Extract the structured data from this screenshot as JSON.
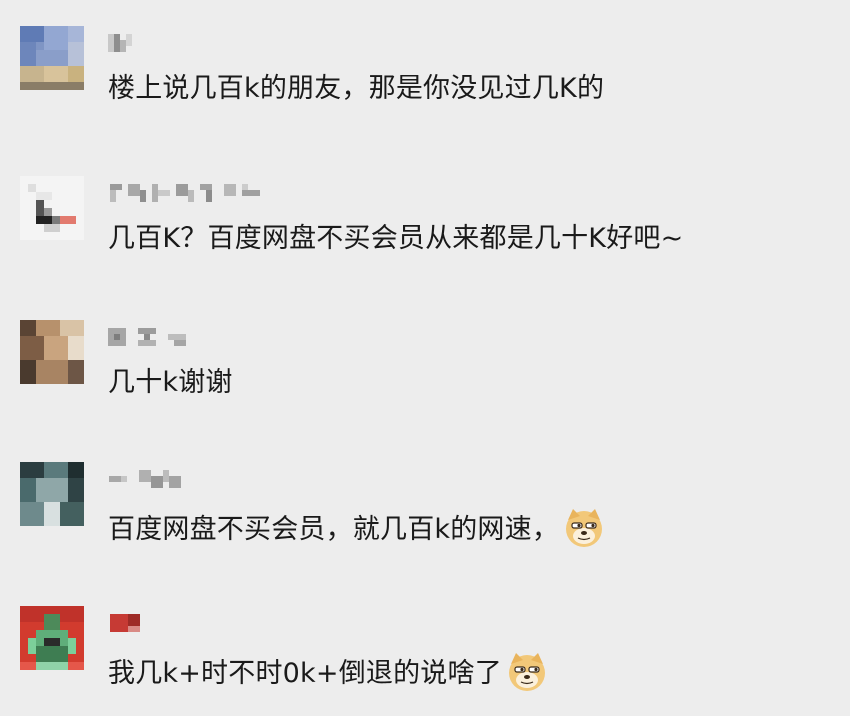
{
  "comments": [
    {
      "text": "楼上说几百k的朋友，那是你没见过几K的",
      "avatar_color": "#7a8fb8",
      "has_emoji": false
    },
    {
      "text": "几百K？百度网盘不买会员从来都是几十K好吧~",
      "avatar_color": "#f2f2f2",
      "has_emoji": false
    },
    {
      "text": "几十k谢谢",
      "avatar_color": "#8b6b52",
      "has_emoji": false
    },
    {
      "text": "百度网盘不买会员，就几百k的网速，",
      "avatar_color": "#3d5a5c",
      "has_emoji": true,
      "emoji": "doge-icon"
    },
    {
      "text": "我几k+时不时0k+倒退的说啥了",
      "avatar_color": "#c0392b",
      "has_emoji": true,
      "emoji": "doge-icon"
    }
  ],
  "colors": {
    "background": "#ededed",
    "text": "#1a1a1a",
    "blur": "#9a9a9a"
  }
}
